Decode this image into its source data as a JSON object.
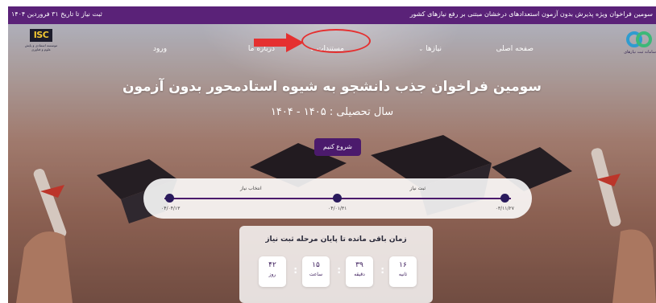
{
  "top_bar": {
    "announcement": "سومین فراخوان ویژه پذیرش بدون آزمون استعدادهای درخشان مبتنی بر رفع نیازهای کشور",
    "deadline": "ثبت نیاز تا تاریخ ۳۱ فروردین ۱۴۰۴"
  },
  "logos": {
    "right_caption": "سامانه ثبت نیازهای",
    "left_text": "ISC",
    "left_caption": "موسسه استنادی و پایش علوم و فناوری"
  },
  "nav": {
    "home": "صفحه اصلی",
    "needs": "نیازها",
    "documents": "مستندات",
    "about": "درباره ما",
    "login": "ورود"
  },
  "hero": {
    "title": "سومین فراخوان جذب دانشجو به شیوه استادمحور بدون آزمون",
    "subtitle": "سال تحصیلی : ۱۴۰۵ - ۱۴۰۴",
    "start_button": "شروع کنیم"
  },
  "timeline": {
    "steps": [
      {
        "label": "ثبت نیاز",
        "date": "۰۳/۱۱/۲۷"
      },
      {
        "label": "انتخاب نیاز",
        "date": "۰۴/۰۱/۳۱"
      },
      {
        "label": "",
        "date": "۰۴/۰۴/۱۳"
      }
    ]
  },
  "countdown": {
    "title": "زمان باقی مانده تا پایان مرحله ثبت نیاز",
    "items": [
      {
        "value": "۱۶",
        "unit": "ثانیه"
      },
      {
        "value": "۳۹",
        "unit": "دقیقه"
      },
      {
        "value": "۱۵",
        "unit": "ساعت"
      },
      {
        "value": "۴۲",
        "unit": "روز"
      }
    ]
  },
  "colors": {
    "brand_purple": "#5a2278",
    "button_purple": "#4b1a6c",
    "highlight_red": "#e53030"
  }
}
